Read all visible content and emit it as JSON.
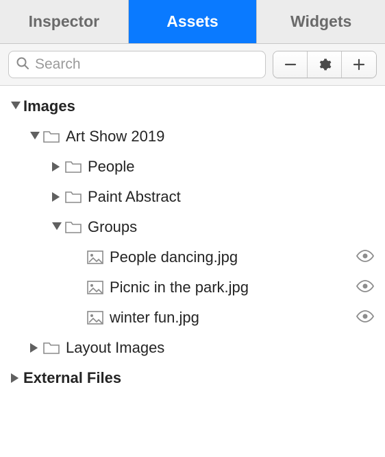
{
  "tabs": {
    "inspector": "Inspector",
    "assets": "Assets",
    "widgets": "Widgets",
    "active": "assets"
  },
  "search": {
    "placeholder": "Search",
    "value": ""
  },
  "tree": {
    "images": "Images",
    "art_show": "Art Show 2019",
    "people": "People",
    "paint_abstract": "Paint Abstract",
    "groups": "Groups",
    "file_people_dancing": "People dancing.jpg",
    "file_picnic": "Picnic in the park.jpg",
    "file_winter": "winter fun.jpg",
    "layout_images": "Layout Images",
    "external_files": "External Files"
  }
}
